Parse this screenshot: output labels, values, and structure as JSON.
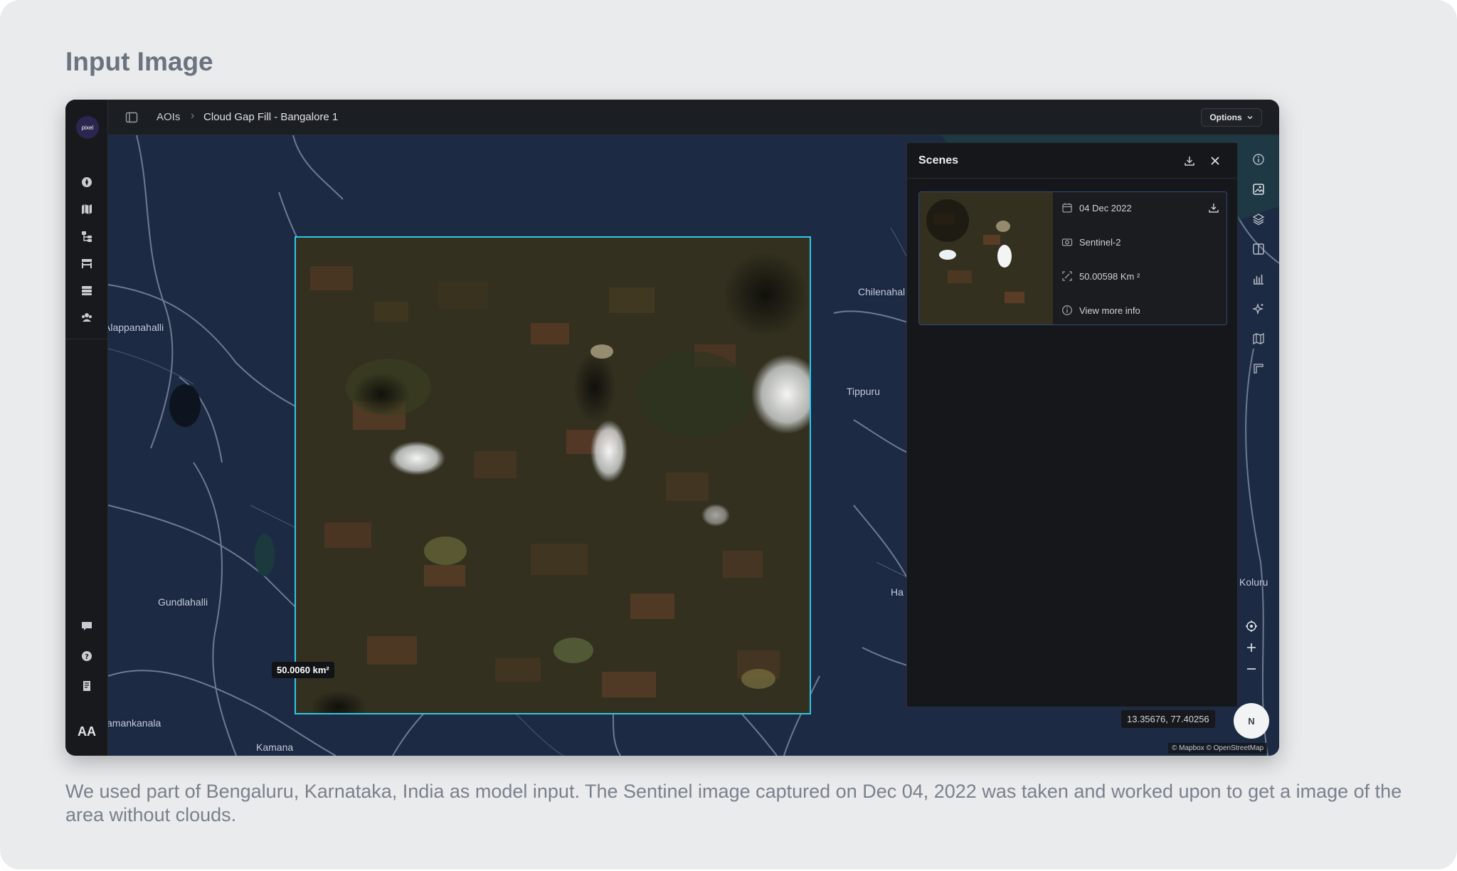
{
  "card": {
    "title": "Input Image",
    "caption": "We used part of Bengaluru, Karnataka, India as model input. The Sentinel image captured on Dec 04, 2022 was taken and worked upon to get a image of the area without clouds."
  },
  "app": {
    "logo_text": "pixel",
    "user_initials": "AA",
    "breadcrumb": {
      "root": "AOIs",
      "separator": "›",
      "current": "Cloud Gap Fill - Bangalore 1"
    },
    "options_label": "Options",
    "left_nav_icons": [
      "compass-icon",
      "map-icon",
      "workflow-icon",
      "store-icon",
      "database-icon",
      "team-icon"
    ],
    "left_nav_bottom_icons": [
      "feedback-icon",
      "help-icon",
      "docs-icon"
    ],
    "map": {
      "places": [
        "Alappanahalli",
        "Chilenahal",
        "Tippuru",
        "Koluru",
        "Gundlahalli",
        "amankanala",
        "Kamana",
        "Ha"
      ],
      "aoi_area_label": "50.0060 km²",
      "coordinates": "13.35676, 77.40256",
      "compass_label": "N",
      "attribution": "© Mapbox © OpenStreetMap",
      "aoi_color": "#2fc6e6"
    },
    "scenes_panel": {
      "title": "Scenes",
      "scene": {
        "date": "04 Dec 2022",
        "satellite": "Sentinel-2",
        "area": "50.00598 Km ²",
        "more_info": "View more info"
      }
    },
    "right_toolbar_icons": [
      "info-icon",
      "image-layer-icon",
      "layers-icon",
      "split-view-icon",
      "chart-icon",
      "sparkle-icon",
      "map-icon",
      "ruler-icon"
    ]
  }
}
